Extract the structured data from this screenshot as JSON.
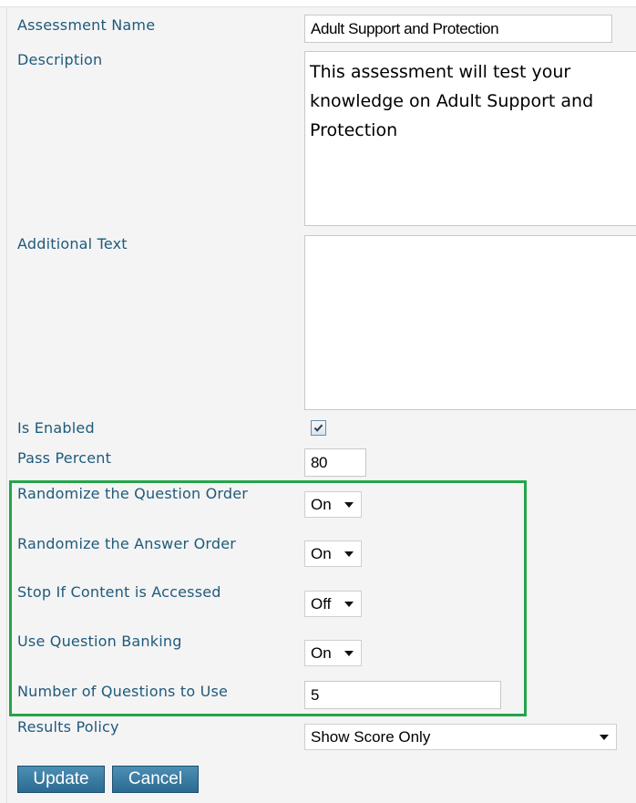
{
  "form": {
    "assessment_name": {
      "label": "Assessment Name",
      "value": "Adult Support and Protection"
    },
    "description": {
      "label": "Description",
      "value": "This assessment will test your knowledge on Adult Support and Protection"
    },
    "additional_text": {
      "label": "Additional Text",
      "value": ""
    },
    "is_enabled": {
      "label": "Is Enabled",
      "checked": true
    },
    "pass_percent": {
      "label": "Pass Percent",
      "value": "80"
    },
    "randomize_question_order": {
      "label": "Randomize the Question Order",
      "value": "On"
    },
    "randomize_answer_order": {
      "label": "Randomize the Answer Order",
      "value": "On"
    },
    "stop_if_content_accessed": {
      "label": "Stop If Content is Accessed",
      "value": "Off"
    },
    "use_question_banking": {
      "label": "Use Question Banking",
      "value": "On"
    },
    "number_of_questions": {
      "label": "Number of Questions to Use",
      "value": "5"
    },
    "results_policy": {
      "label": "Results Policy",
      "value": "Show Score Only"
    }
  },
  "buttons": {
    "update": "Update",
    "cancel": "Cancel"
  },
  "colors": {
    "label": "#1e5a7c",
    "highlight_border": "#23a54a",
    "button": "#2c6a91"
  },
  "icons": {
    "dropdown": "caret-down-icon",
    "checkbox": "checkmark-icon"
  }
}
